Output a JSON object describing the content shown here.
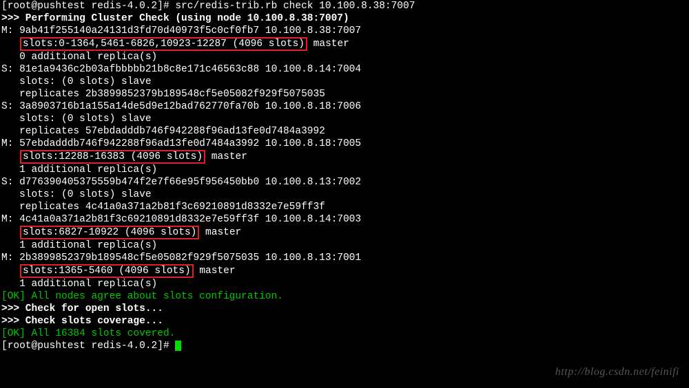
{
  "prompt1": "[root@pushtest redis-4.0.2]# src/redis-trib.rb check 10.100.8.38:7007",
  "header": ">>> Performing Cluster Check (using node 10.100.8.38:7007)",
  "node1_line1": "M: 9ab41f255140a24131d3fd70d40973f5c0cf0fb7 10.100.8.38:7007",
  "node1_boxed": "slots:0-1364,5461-6826,10923-12287 (4096 slots)",
  "node1_after": " master",
  "node1_replica": "   0 additional replica(s)",
  "node2_line1": "S: 81e1a9436c2b03afbbbbb21b8c8e171c46563c88 10.100.8.14:7004",
  "node2_slots": "   slots: (0 slots) slave",
  "node2_replicates": "   replicates 2b3899852379b189548cf5e05082f929f5075035",
  "node3_line1": "S: 3a8903716b1a155a14de5d9e12bad762770fa70b 10.100.8.18:7006",
  "node3_slots": "   slots: (0 slots) slave",
  "node3_replicates": "   replicates 57ebdadddb746f942288f96ad13fe0d7484a3992",
  "node4_line1": "M: 57ebdadddb746f942288f96ad13fe0d7484a3992 10.100.8.18:7005",
  "node4_boxed": "slots:12288-16383 (4096 slots)",
  "node4_after": " master",
  "node4_replica": "   1 additional replica(s)",
  "node5_line1": "S: d776390405375559b474f2e7f66e95f956450bb0 10.100.8.13:7002",
  "node5_slots": "   slots: (0 slots) slave",
  "node5_replicates": "   replicates 4c41a0a371a2b81f3c69210891d8332e7e59ff3f",
  "node6_line1": "M: 4c41a0a371a2b81f3c69210891d8332e7e59ff3f 10.100.8.14:7003",
  "node6_boxed": "slots:6827-10922 (4096 slots)",
  "node6_after": " master",
  "node6_replica": "   1 additional replica(s)",
  "node7_line1": "M: 2b3899852379b189548cf5e05082f929f5075035 10.100.8.13:7001",
  "node7_boxed": "slots:1365-5460 (4096 slots)",
  "node7_after": " master",
  "node7_replica": "   1 additional replica(s)",
  "ok1": "[OK] All nodes agree about slots configuration.",
  "check1": ">>> Check for open slots...",
  "check2": ">>> Check slots coverage...",
  "ok2": "[OK] All 16384 slots covered.",
  "prompt2": "[root@pushtest redis-4.0.2]# ",
  "watermark": "http://blog.csdn.net/feinifi"
}
